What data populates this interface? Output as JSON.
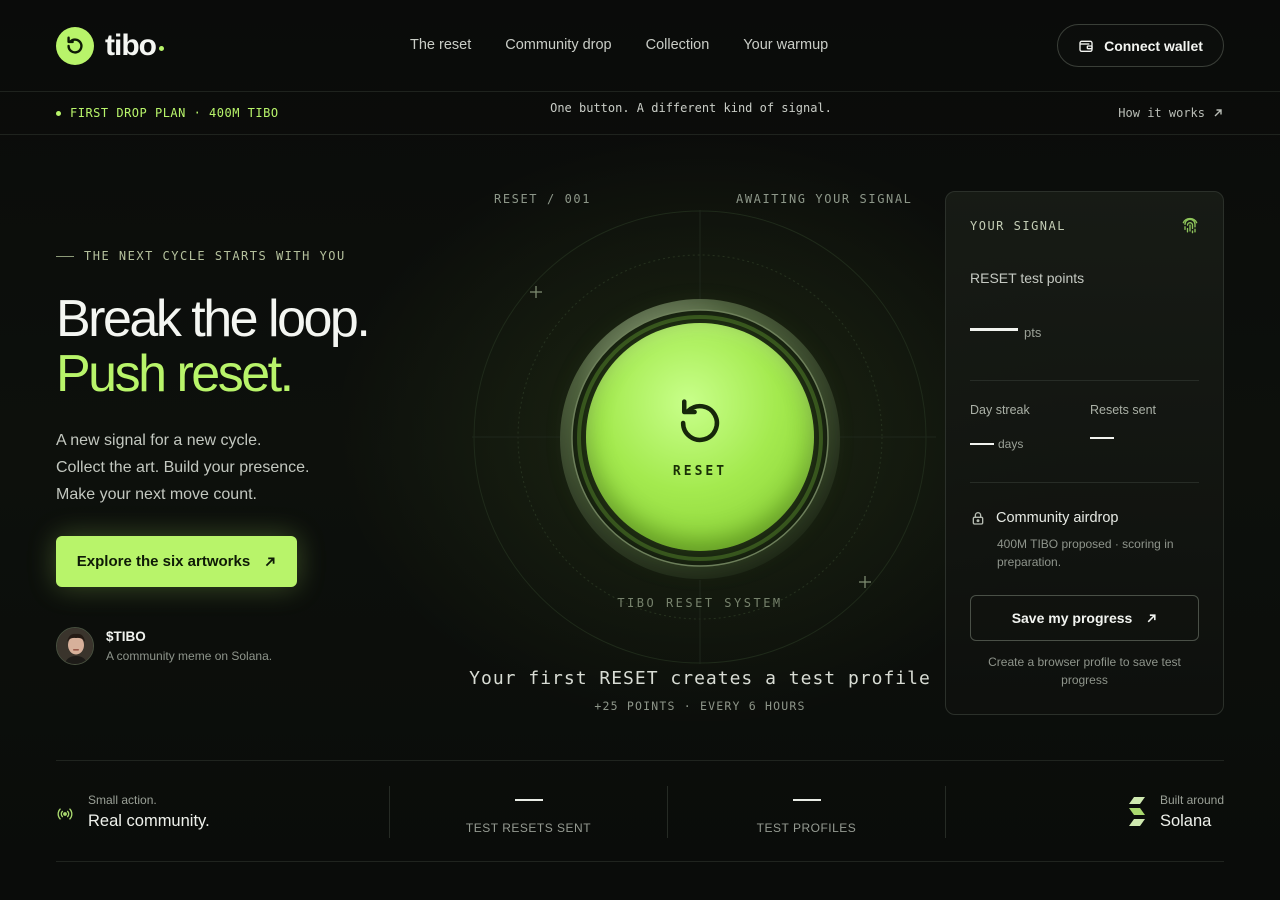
{
  "brand": {
    "name": "tibo",
    "accent": "#b8f46a"
  },
  "nav": {
    "items": [
      "The reset",
      "Community drop",
      "Collection",
      "Your warmup"
    ]
  },
  "header": {
    "connect_label": "Connect wallet"
  },
  "subbar": {
    "left": "FIRST DROP PLAN · 400M TIBO",
    "center": "One button. A different kind of signal.",
    "right": "How it works"
  },
  "hero": {
    "eyebrow": "THE NEXT CYCLE STARTS WITH YOU",
    "title_line1": "Break the loop.",
    "title_line2": "Push reset.",
    "lead": [
      "A new signal for a new cycle.",
      "Collect the art. Build your presence.",
      "Make your next move count."
    ],
    "cta": "Explore the six artworks",
    "token_name": "$TIBO",
    "token_desc": "A community meme on Solana."
  },
  "stage": {
    "top_left": "RESET / 001",
    "top_right": "AWAITING YOUR SIGNAL",
    "button_label": "RESET",
    "system_label": "TIBO RESET SYSTEM",
    "tagline": "Your first RESET creates a test profile",
    "sub_tagline": "+25 POINTS · EVERY 6 HOURS"
  },
  "card": {
    "title": "YOUR SIGNAL",
    "points_label": "RESET test points",
    "points_unit": "pts",
    "streak_label": "Day streak",
    "streak_unit": "days",
    "resets_label": "Resets sent",
    "airdrop_title": "Community airdrop",
    "airdrop_desc": "400M TIBO proposed · scoring in preparation.",
    "save_label": "Save my progress",
    "note": "Create a browser profile to save test progress"
  },
  "bottom": {
    "left_small": "Small action.",
    "left_big": "Real community.",
    "stat1_label": "TEST RESETS SENT",
    "stat2_label": "TEST PROFILES",
    "right_small": "Built around",
    "right_big": "Solana"
  },
  "icons": {
    "logo": "reset-arrow-icon",
    "wallet": "wallet-icon",
    "arrow": "arrow-up-right-icon",
    "fingerprint": "fingerprint-icon",
    "lock": "lock-icon",
    "signal": "broadcast-icon",
    "solana": "solana-logo-icon"
  }
}
